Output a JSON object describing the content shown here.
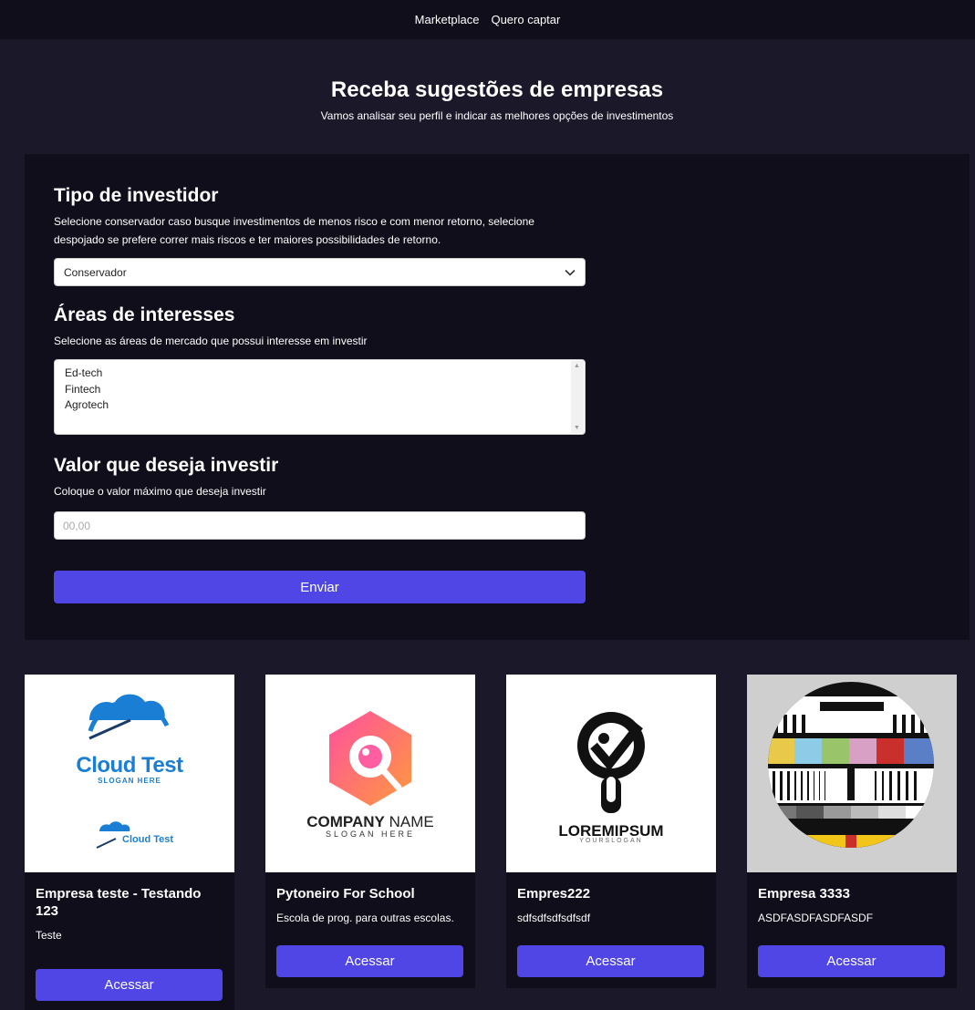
{
  "nav": {
    "items": [
      "Marketplace",
      "Quero captar"
    ]
  },
  "hero": {
    "title": "Receba sugestões de empresas",
    "subtitle": "Vamos analisar seu perfil e indicar as melhores opções de investimentos"
  },
  "form": {
    "investor_type": {
      "heading": "Tipo de investidor",
      "description": "Selecione conservador caso busque investimentos de menos risco e com menor retorno, selecione despojado se prefere correr mais riscos e ter maiores possibilidades de retorno.",
      "selected": "Conservador"
    },
    "areas": {
      "heading": "Áreas de interesses",
      "description": "Selecione as áreas de mercado que possui interesse em investir",
      "options": [
        "Ed-tech",
        "Fintech",
        "Agrotech"
      ]
    },
    "amount": {
      "heading": "Valor que deseja investir",
      "description": "Coloque o valor máximo que deseja investir",
      "placeholder": "00,00"
    },
    "submit_label": "Enviar"
  },
  "cards": [
    {
      "title": "Empresa teste - Testando 123",
      "description": "Teste",
      "button": "Acessar",
      "logo": {
        "name": "Cloud Test",
        "slogan": "SLOGAN HERE",
        "icon": "cloud-speedometer-icon"
      }
    },
    {
      "title": "Pytoneiro For School",
      "description": "Escola de prog. para outras escolas.",
      "button": "Acessar",
      "logo": {
        "name_bold": "COMPANY",
        "name_light": " NAME",
        "slogan": "SLOGAN HERE",
        "icon": "hexagon-magnifier-icon"
      }
    },
    {
      "title": "Empres222",
      "description": "sdfsdfsdfsdfsdf",
      "button": "Acessar",
      "logo": {
        "name": "LOREMIPSUM",
        "slogan": "YOURSLOGAN",
        "icon": "magnifier-check-icon"
      }
    },
    {
      "title": "Empresa 3333",
      "description": "ASDFASDFASDFASDF",
      "button": "Acessar",
      "logo": {
        "icon": "tv-test-pattern-icon"
      }
    }
  ],
  "colors": {
    "background": "#1a1829",
    "panel": "#0f0e1a",
    "accent": "#4f46e5",
    "cloud_blue": "#1a7fd4",
    "hex_gradient_start": "#ff4fa0",
    "hex_gradient_end": "#ff9a3c"
  }
}
